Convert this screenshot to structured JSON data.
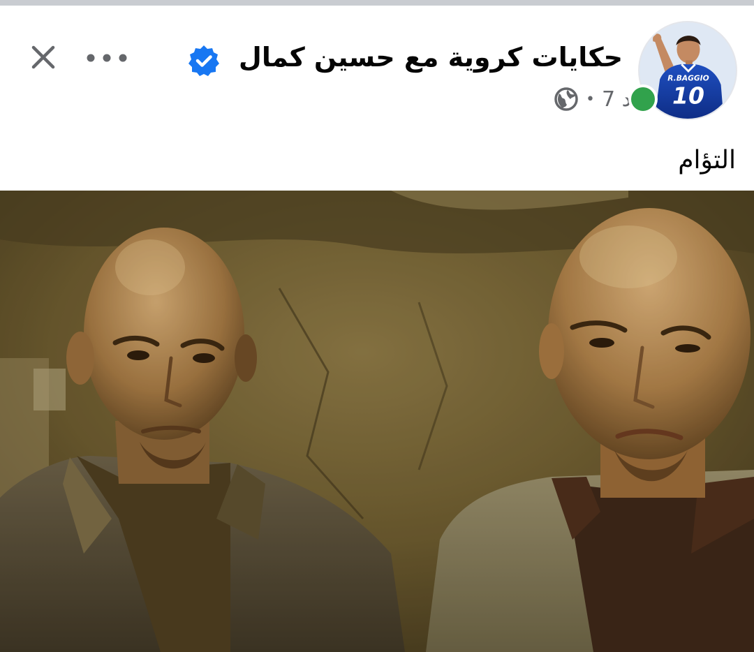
{
  "post": {
    "page_name": "حكايات كروية مع حسين كمال",
    "time": "7 د",
    "separator": "•",
    "text": "التؤام"
  },
  "icons": {
    "verified": "verified-badge-icon",
    "audience": "globe-icon",
    "more": "more-options-icon",
    "close": "close-icon"
  },
  "avatar": {
    "jersey_name": "R.BAGGIO",
    "jersey_number": "10"
  },
  "colors": {
    "verified": "#1877f2",
    "online": "#31a24c",
    "text_primary": "#050505",
    "text_secondary": "#65676b"
  }
}
